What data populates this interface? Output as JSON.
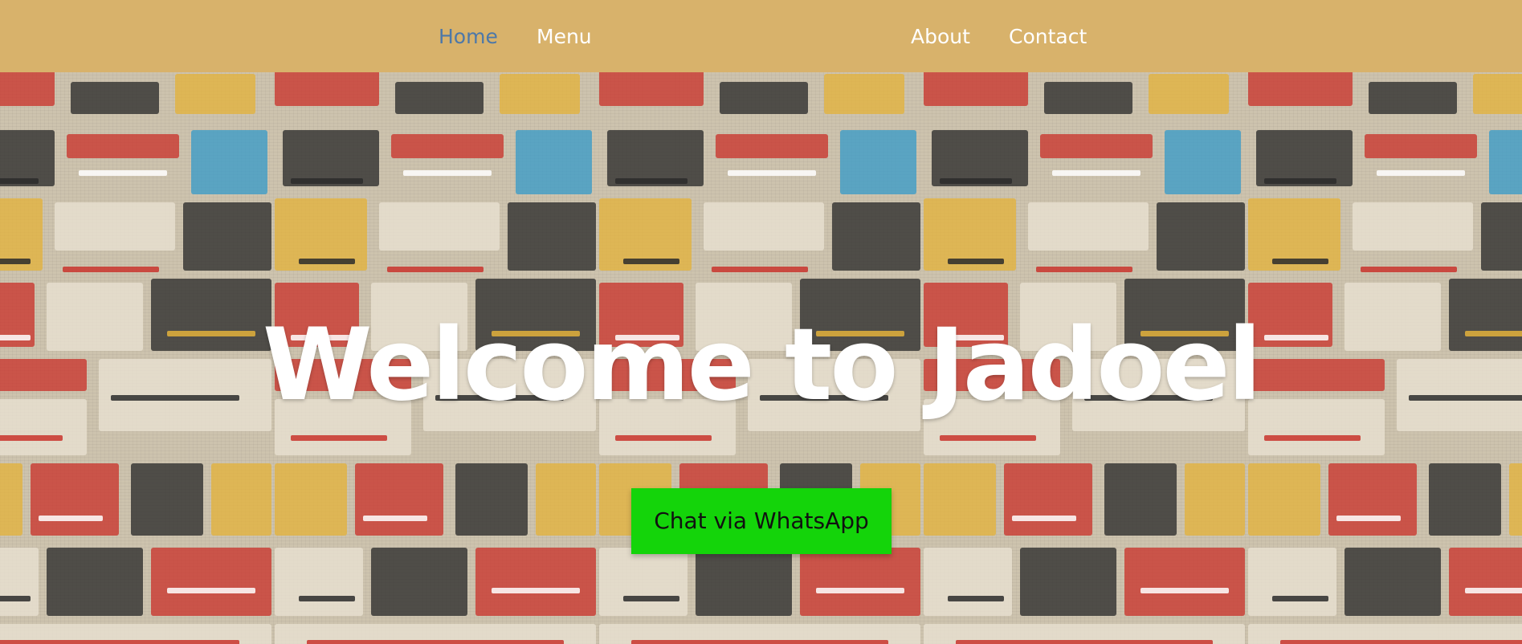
{
  "nav": {
    "items": [
      {
        "label": "Home",
        "active": true
      },
      {
        "label": "Menu",
        "active": false
      },
      {
        "label": "About",
        "active": false
      },
      {
        "label": "Contact",
        "active": false
      }
    ]
  },
  "hero": {
    "title": "Welcome to Jadoel",
    "cta_label": "Chat via WhatsApp",
    "background": "retro-vintage-advertisement-collage"
  },
  "colors": {
    "navbar_bg": "#d8b26b",
    "nav_active": "#4d78a8",
    "nav_text": "#ffffff",
    "cta_bg": "#14d40a",
    "cta_text": "#111111"
  }
}
